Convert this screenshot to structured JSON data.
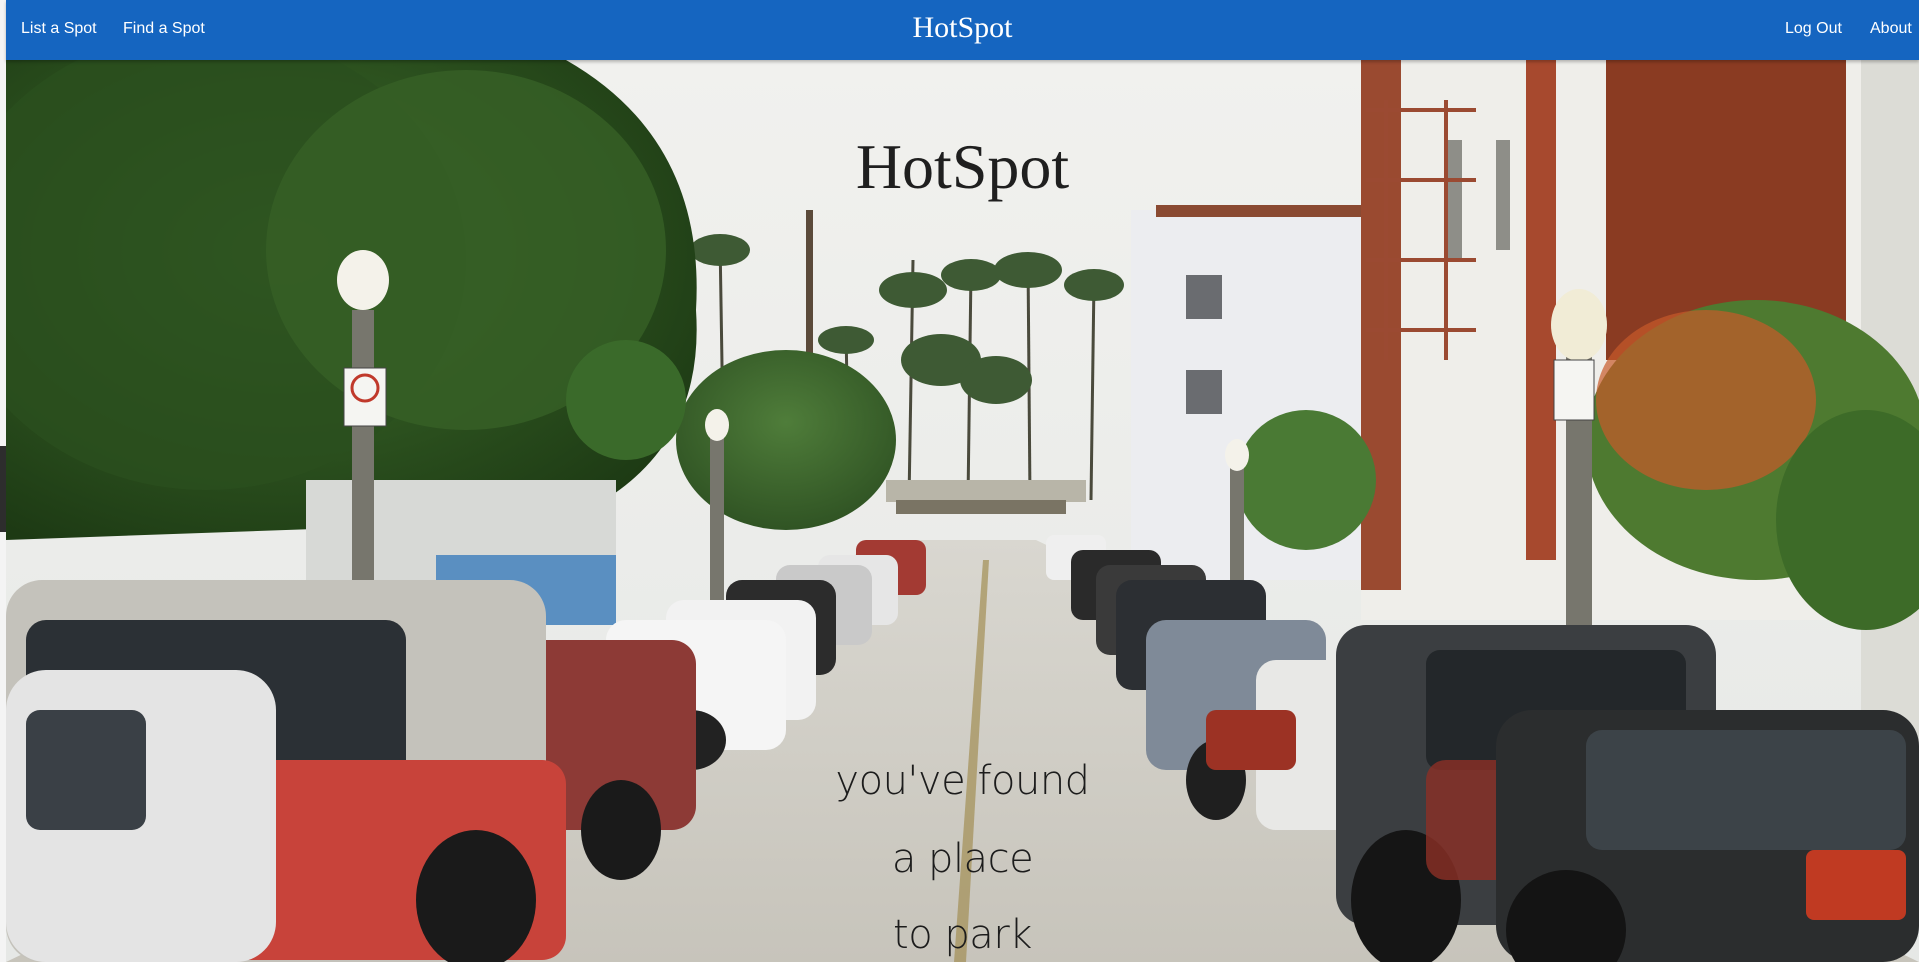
{
  "navbar": {
    "brand": "HotSpot",
    "left_links": [
      "List a Spot",
      "Find a Spot"
    ],
    "right_links": [
      "Log Out",
      "About"
    ],
    "background_color": "#1565c0"
  },
  "hero": {
    "title": "HotSpot",
    "tagline_lines": [
      "you've found",
      "a place",
      "to park"
    ],
    "background_image": "street lined with parked cars, palm trees and buildings"
  }
}
